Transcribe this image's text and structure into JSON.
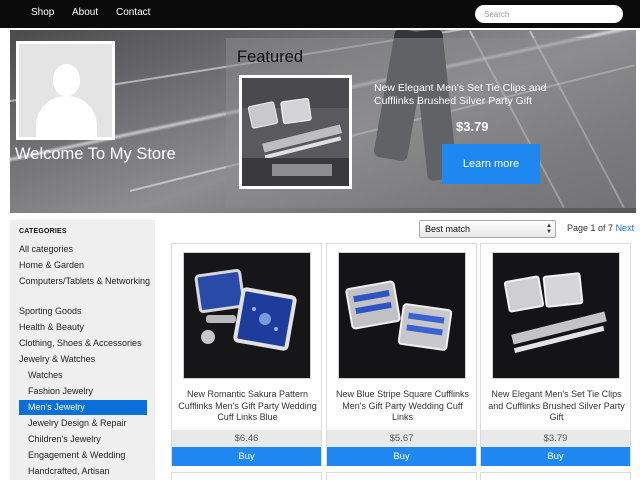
{
  "nav": {
    "links": [
      "Shop",
      "About",
      "Contact"
    ],
    "search_placeholder": "Search"
  },
  "hero": {
    "welcome": "Welcome To My Store",
    "featured_title": "Featured",
    "featured_product_name": "New Elegant Men's Set Tie Clips and Cufflinks Brushed Silver Party Gift",
    "featured_price": "$3.79",
    "learn_more": "Learn more"
  },
  "sidebar": {
    "heading": "CATEGORIES",
    "items": [
      {
        "label": "All categories",
        "level": 0
      },
      {
        "label": "Home & Garden",
        "level": 0
      },
      {
        "label": "Computers/Tablets & Networking",
        "level": 0
      },
      {
        "label": "Sporting Goods",
        "level": 0
      },
      {
        "label": "Health & Beauty",
        "level": 0
      },
      {
        "label": "Clothing, Shoes & Accessories",
        "level": 0
      },
      {
        "label": "Jewelry & Watches",
        "level": 0
      },
      {
        "label": "Watches",
        "level": 1
      },
      {
        "label": "Fashion Jewelry",
        "level": 1
      },
      {
        "label": "Men's Jewelry",
        "level": 1,
        "selected": true
      },
      {
        "label": "Jewelry Design & Repair",
        "level": 1
      },
      {
        "label": "Children's Jewelry",
        "level": 1
      },
      {
        "label": "Engagement & Wedding",
        "level": 1
      },
      {
        "label": "Handcrafted, Artisan",
        "level": 1
      }
    ]
  },
  "toolbar": {
    "sort_selected": "Best match",
    "page_text": "Page 1 of 7",
    "next_label": "Next"
  },
  "products": [
    {
      "title": "New Romantic Sakura Pattern Cufflinks Men's Gift Party Wedding Cuff Links Blue",
      "price": "$6.46",
      "buy_label": "Buy"
    },
    {
      "title": "New Blue Stripe Square Cufflinks Men's Gift Party Wedding Cuff Links",
      "price": "$5.67",
      "buy_label": "Buy"
    },
    {
      "title": "New Elegant Men's Set Tie Clips and Cufflinks Brushed Silver Party Gift",
      "price": "$3.79",
      "buy_label": "Buy"
    }
  ],
  "colors": {
    "accent": "#1e88f0",
    "selected_category": "#0a6fd8",
    "nav_bg": "#0b0b0b",
    "sidebar_bg": "#efefef"
  }
}
